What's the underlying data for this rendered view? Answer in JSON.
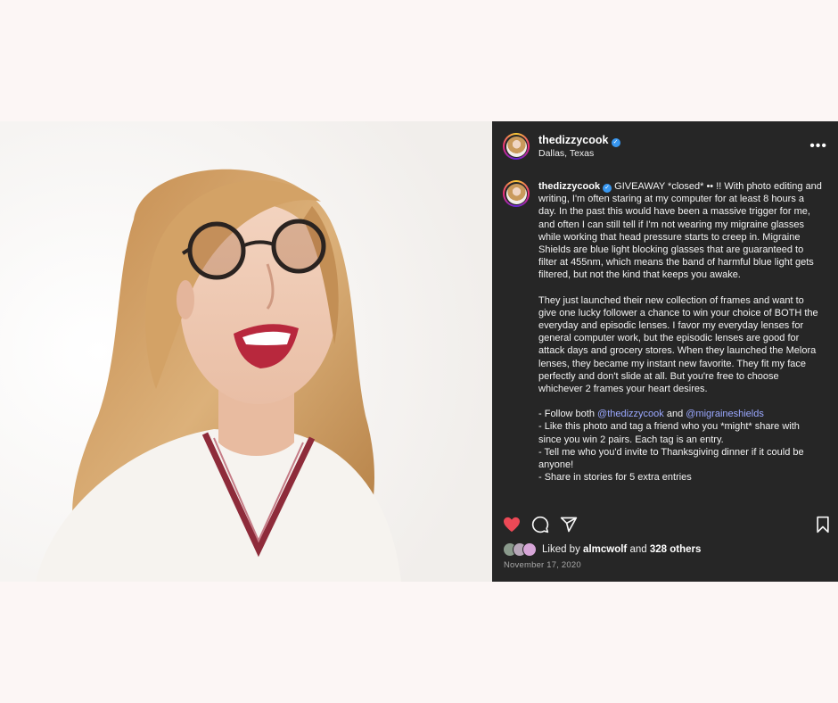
{
  "post": {
    "username": "thedizzycook",
    "location": "Dallas, Texas",
    "caption": {
      "intro": "GIVEAWAY *closed* •• !! With photo editing and writing, I'm often staring at my computer for at least 8 hours a day. In the past this would have been a massive trigger for me, and often I can still tell if I'm not wearing my migraine glasses while working that head pressure starts to creep in. Migraine Shields are blue light blocking glasses that are guaranteed to filter at 455nm, which means the band of harmful blue light gets filtered, but not the kind that keeps you awake.",
      "paragraph2": "They just launched their new collection of frames and want to give one lucky follower a chance to win your choice of BOTH the everyday and episodic lenses. I favor my everyday lenses for general computer work, but the episodic lenses are good for attack days and grocery stores. When they launched the Melora lenses, they became my instant new favorite. They fit my face perfectly and don't slide at all. But you're free to choose whichever 2 frames your heart desires.",
      "rule1_prefix": "- Follow both ",
      "rule1_mention1": "@thedizzycook",
      "rule1_and": " and ",
      "rule1_mention2": "@migraineshields",
      "rule2": "- Like this photo and tag a friend who you *might* share with since you win 2 pairs. Each tag is an entry.",
      "rule3": "- Tell me who you'd invite to Thanksgiving dinner if it could be anyone!",
      "rule4": "- Share in stories for 5 extra entries"
    },
    "likes": {
      "prefix": "Liked by ",
      "user": "almcwolf",
      "middle": " and ",
      "others": "328 others"
    },
    "date": "November 17, 2020",
    "icons": [
      "heart-icon",
      "comment-icon",
      "share-icon",
      "bookmark-icon",
      "more-icon",
      "verified-icon"
    ],
    "colors": {
      "panel_bg": "#262626",
      "like_red": "#ed4956",
      "mention": "#9aa8ff",
      "verified": "#3897f0"
    }
  }
}
